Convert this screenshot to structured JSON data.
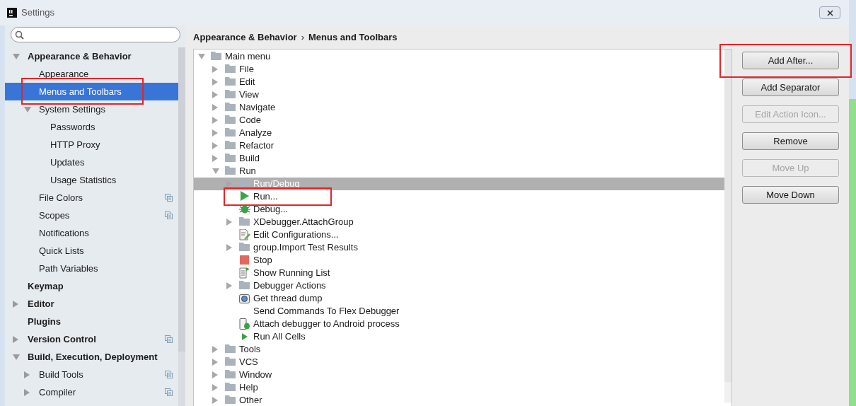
{
  "window": {
    "title": "Settings"
  },
  "sidebar": {
    "items": [
      {
        "label": "Appearance & Behavior",
        "kind": "group",
        "expanded": true,
        "selected": false,
        "highlighted": false,
        "project_icon": false,
        "children": [
          {
            "label": "Appearance",
            "kind": "page",
            "selected": false,
            "highlighted": false,
            "project_icon": false
          },
          {
            "label": "Menus and Toolbars",
            "kind": "page",
            "selected": true,
            "highlighted": true,
            "project_icon": false
          },
          {
            "label": "System Settings",
            "kind": "group",
            "expanded": true,
            "selected": false,
            "highlighted": false,
            "project_icon": false,
            "children": [
              {
                "label": "Passwords",
                "kind": "page",
                "selected": false,
                "highlighted": false,
                "project_icon": false
              },
              {
                "label": "HTTP Proxy",
                "kind": "page",
                "selected": false,
                "highlighted": false,
                "project_icon": false
              },
              {
                "label": "Updates",
                "kind": "page",
                "selected": false,
                "highlighted": false,
                "project_icon": false
              },
              {
                "label": "Usage Statistics",
                "kind": "page",
                "selected": false,
                "highlighted": false,
                "project_icon": false
              }
            ]
          },
          {
            "label": "File Colors",
            "kind": "page",
            "selected": false,
            "highlighted": false,
            "project_icon": true
          },
          {
            "label": "Scopes",
            "kind": "page",
            "selected": false,
            "highlighted": false,
            "project_icon": true
          },
          {
            "label": "Notifications",
            "kind": "page",
            "selected": false,
            "highlighted": false,
            "project_icon": false
          },
          {
            "label": "Quick Lists",
            "kind": "page",
            "selected": false,
            "highlighted": false,
            "project_icon": false
          },
          {
            "label": "Path Variables",
            "kind": "page",
            "selected": false,
            "highlighted": false,
            "project_icon": false
          }
        ]
      },
      {
        "label": "Keymap",
        "kind": "page",
        "selected": false,
        "highlighted": false,
        "project_icon": false
      },
      {
        "label": "Editor",
        "kind": "group",
        "expanded": false,
        "selected": false,
        "highlighted": false,
        "project_icon": false
      },
      {
        "label": "Plugins",
        "kind": "page",
        "selected": false,
        "highlighted": false,
        "project_icon": false
      },
      {
        "label": "Version Control",
        "kind": "group",
        "expanded": false,
        "selected": false,
        "highlighted": false,
        "project_icon": true
      },
      {
        "label": "Build, Execution, Deployment",
        "kind": "group",
        "expanded": true,
        "selected": false,
        "highlighted": false,
        "project_icon": false,
        "children": [
          {
            "label": "Build Tools",
            "kind": "group",
            "expanded": false,
            "selected": false,
            "highlighted": false,
            "project_icon": true
          },
          {
            "label": "Compiler",
            "kind": "group",
            "expanded": false,
            "selected": false,
            "highlighted": false,
            "project_icon": true
          }
        ]
      }
    ]
  },
  "breadcrumb": {
    "items": [
      "Appearance & Behavior",
      "Menus and Toolbars"
    ],
    "separator": "›"
  },
  "tree": {
    "items": [
      {
        "label": "Main menu",
        "kind": "folder",
        "expanded": true,
        "selected": false,
        "highlighted": false,
        "children": [
          {
            "label": "File",
            "kind": "folder",
            "expanded": false,
            "selected": false,
            "highlighted": false
          },
          {
            "label": "Edit",
            "kind": "folder",
            "expanded": false,
            "selected": false,
            "highlighted": false
          },
          {
            "label": "View",
            "kind": "folder",
            "expanded": false,
            "selected": false,
            "highlighted": false
          },
          {
            "label": "Navigate",
            "kind": "folder",
            "expanded": false,
            "selected": false,
            "highlighted": false
          },
          {
            "label": "Code",
            "kind": "folder",
            "expanded": false,
            "selected": false,
            "highlighted": false
          },
          {
            "label": "Analyze",
            "kind": "folder",
            "expanded": false,
            "selected": false,
            "highlighted": false
          },
          {
            "label": "Refactor",
            "kind": "folder",
            "expanded": false,
            "selected": false,
            "highlighted": false
          },
          {
            "label": "Build",
            "kind": "folder",
            "expanded": false,
            "selected": false,
            "highlighted": false
          },
          {
            "label": "Run",
            "kind": "folder",
            "expanded": true,
            "selected": false,
            "highlighted": false,
            "children": [
              {
                "label": "Run/Debug",
                "kind": "folder",
                "expanded": false,
                "selected": true,
                "highlighted": false
              },
              {
                "label": "Run...",
                "kind": "run",
                "selected": false,
                "highlighted": true
              },
              {
                "label": "Debug...",
                "kind": "bug",
                "selected": false,
                "highlighted": false
              },
              {
                "label": "XDebugger.AttachGroup",
                "kind": "folder",
                "expanded": false,
                "selected": false,
                "highlighted": false
              },
              {
                "label": "Edit Configurations...",
                "kind": "editdoc",
                "selected": false,
                "highlighted": false
              },
              {
                "label": "group.Import Test Results",
                "kind": "folder",
                "expanded": false,
                "selected": false,
                "highlighted": false
              },
              {
                "label": "Stop",
                "kind": "stop",
                "selected": false,
                "highlighted": false
              },
              {
                "label": "Show Running List",
                "kind": "list",
                "selected": false,
                "highlighted": false
              },
              {
                "label": "Debugger Actions",
                "kind": "folder",
                "expanded": false,
                "selected": false,
                "highlighted": false
              },
              {
                "label": "Get thread dump",
                "kind": "camera",
                "selected": false,
                "highlighted": false
              },
              {
                "label": "Send Commands To Flex Debugger",
                "kind": "plain",
                "selected": false,
                "highlighted": false
              },
              {
                "label": "Attach debugger to Android process",
                "kind": "phonebug",
                "selected": false,
                "highlighted": false
              },
              {
                "label": "Run All Cells",
                "kind": "runsmall",
                "selected": false,
                "highlighted": false
              }
            ]
          },
          {
            "label": "Tools",
            "kind": "folder",
            "expanded": false,
            "selected": false,
            "highlighted": false
          },
          {
            "label": "VCS",
            "kind": "folder",
            "expanded": false,
            "selected": false,
            "highlighted": false
          },
          {
            "label": "Window",
            "kind": "folder",
            "expanded": false,
            "selected": false,
            "highlighted": false
          },
          {
            "label": "Help",
            "kind": "folder",
            "expanded": false,
            "selected": false,
            "highlighted": false
          },
          {
            "label": "Other",
            "kind": "folder",
            "expanded": false,
            "selected": false,
            "highlighted": false
          }
        ]
      }
    ]
  },
  "buttons": [
    {
      "label": "Add After...",
      "disabled": false,
      "highlighted": true
    },
    {
      "label": "Add Separator",
      "disabled": false,
      "highlighted": false
    },
    {
      "label": "Edit Action Icon...",
      "disabled": true,
      "highlighted": false
    },
    {
      "label": "Remove",
      "disabled": false,
      "highlighted": false
    },
    {
      "label": "Move Up",
      "disabled": true,
      "highlighted": false
    },
    {
      "label": "Move Down",
      "disabled": false,
      "highlighted": false
    }
  ]
}
